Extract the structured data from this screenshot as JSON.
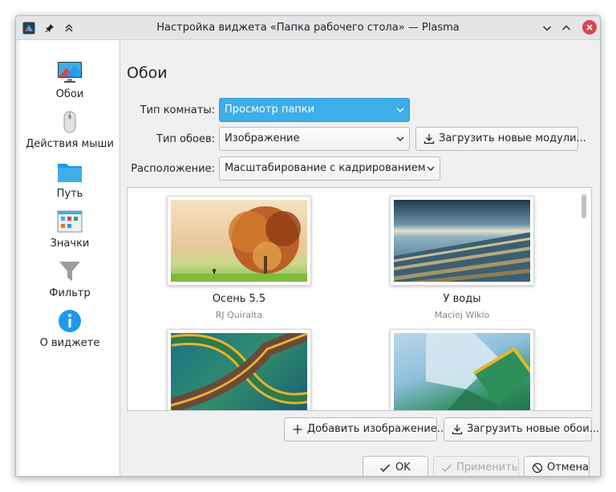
{
  "window": {
    "title": "Настройка виджета «Папка рабочего стола» — Plasma"
  },
  "sidebar": {
    "items": [
      {
        "label": "Обои",
        "icon": "monitor-icon"
      },
      {
        "label": "Действия мыши",
        "icon": "mouse-icon"
      },
      {
        "label": "Путь",
        "icon": "folder-icon"
      },
      {
        "label": "Значки",
        "icon": "icons-grid-icon"
      },
      {
        "label": "Фильтр",
        "icon": "filter-icon"
      },
      {
        "label": "О виджете",
        "icon": "info-icon"
      }
    ]
  },
  "page": {
    "title": "Обои",
    "layout_label": "Тип комнаты:",
    "layout_value": "Просмотр папки",
    "wallpaper_type_label": "Тип обоев:",
    "wallpaper_type_value": "Изображение",
    "get_plugins_label": "Загрузить новые модули...",
    "positioning_label": "Расположение:",
    "positioning_value": "Масштабирование с кадрированием"
  },
  "wallpapers": [
    {
      "name": "Осень 5.5",
      "author": "RJ Quiralta"
    },
    {
      "name": "У воды",
      "author": "Maciej Wiklo"
    },
    {
      "name": "",
      "author": ""
    },
    {
      "name": "",
      "author": ""
    }
  ],
  "actions": {
    "add_image_label": "Добавить изображение...",
    "get_wallpapers_label": "Загрузить новые обои..."
  },
  "dialog_buttons": {
    "ok_label": "OK",
    "apply_label": "Применить",
    "cancel_label": "Отмена"
  },
  "colors": {
    "accent": "#3daee9",
    "close": "#da4453"
  }
}
